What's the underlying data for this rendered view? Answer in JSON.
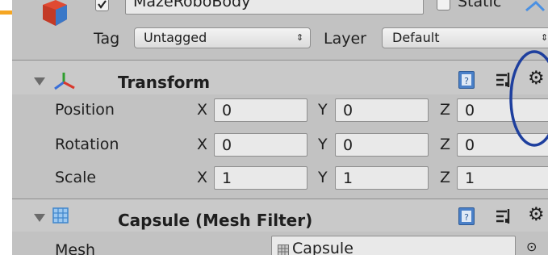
{
  "gameobject": {
    "name": "MazeRoboBody",
    "static_label": "Static",
    "tag_label": "Tag",
    "tag_value": "Untagged",
    "layer_label": "Layer",
    "layer_value": "Default"
  },
  "transform": {
    "title": "Transform",
    "rows": [
      {
        "label": "Position",
        "x": "0",
        "y": "0",
        "z": "0"
      },
      {
        "label": "Rotation",
        "x": "0",
        "y": "0",
        "z": "0"
      },
      {
        "label": "Scale",
        "x": "1",
        "y": "1",
        "z": "1"
      }
    ]
  },
  "mesh_filter": {
    "title": "Capsule (Mesh Filter)",
    "mesh_label": "Mesh",
    "mesh_value": "Capsule"
  },
  "axis": {
    "x": "X",
    "y": "Y",
    "z": "Z"
  },
  "annotation": {
    "color": "#1e3f9e"
  }
}
